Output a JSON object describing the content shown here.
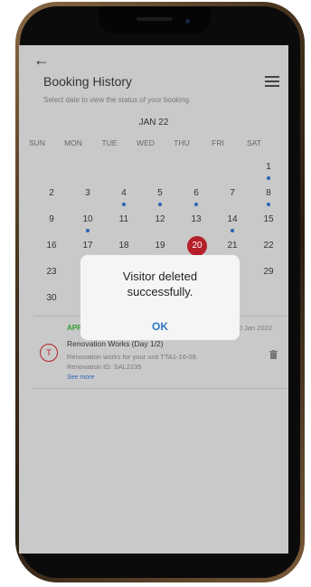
{
  "header": {
    "back_icon": "back-arrow-icon",
    "title": "Booking History",
    "menu_icon": "list-icon",
    "subtitle": "Select date to view the status of your booking."
  },
  "calendar": {
    "month": "JAN 22",
    "weekdays": [
      "SUN",
      "MON",
      "TUE",
      "WED",
      "THU",
      "FRI",
      "SAT"
    ],
    "selected_day": "20",
    "rows": [
      [
        "",
        "",
        "",
        "",
        "",
        "",
        "1"
      ],
      [
        "2",
        "3",
        "4",
        "5",
        "6",
        "7",
        "8"
      ],
      [
        "9",
        "10",
        "11",
        "12",
        "13",
        "14",
        "15"
      ],
      [
        "16",
        "17",
        "18",
        "19",
        "20",
        "21",
        "22"
      ],
      [
        "23",
        "",
        "",
        "",
        "",
        "",
        "29"
      ],
      [
        "30",
        "",
        "",
        "",
        "",
        "",
        ""
      ]
    ],
    "dot_color": "#2b63b5",
    "selected_color": "#b51f2a"
  },
  "booking": {
    "status": "APP",
    "date": "20 Jan 2022",
    "title": "Renovation Works (Day 1/2)",
    "desc1": "Renovation works for your unit TTA1-16-09.",
    "desc2": "Renovation ID: SAL2235",
    "see_more": "See more",
    "icon": "renovation-icon",
    "delete_icon": "trash-icon"
  },
  "dialog": {
    "line1": "Visitor deleted",
    "line2": "successfully.",
    "ok": "OK"
  }
}
